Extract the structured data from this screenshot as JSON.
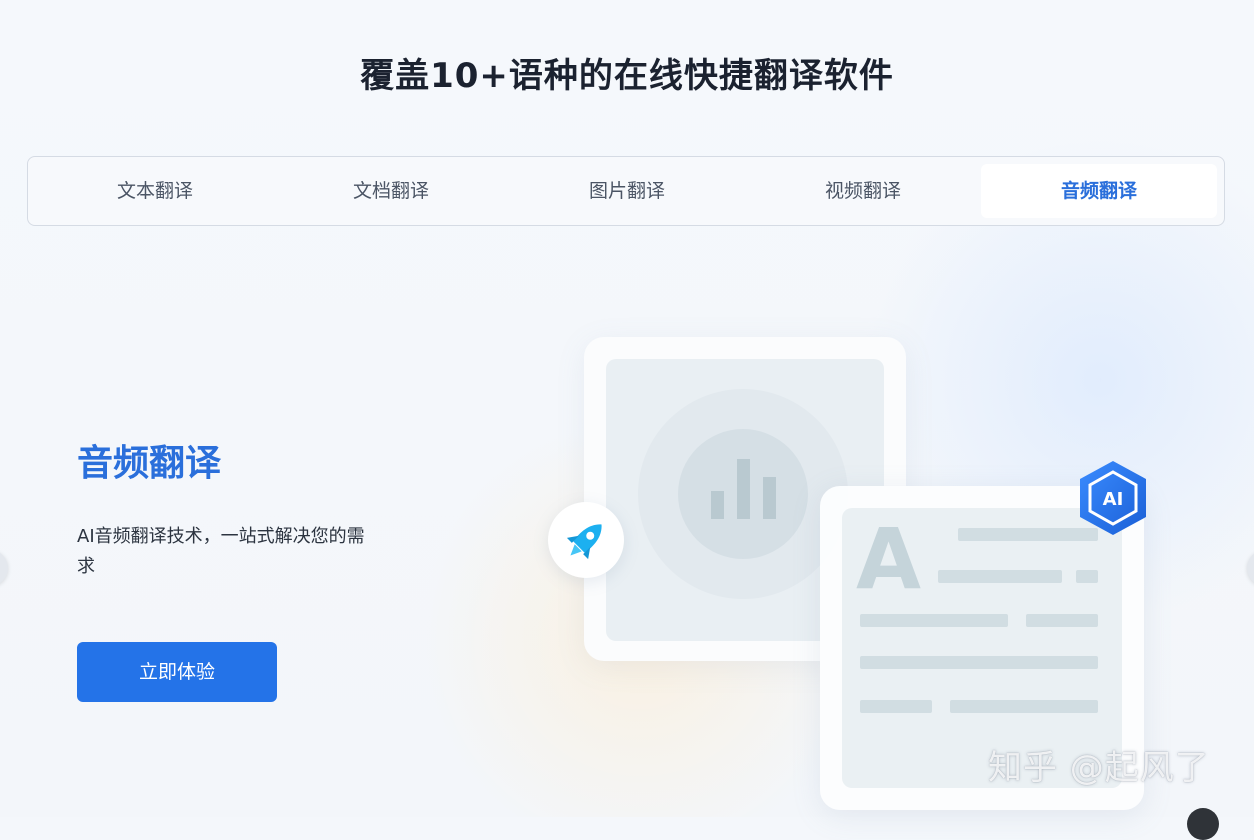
{
  "headline": "覆盖10+语种的在线快捷翻译软件",
  "tabs": [
    {
      "label": "文本翻译",
      "active": false
    },
    {
      "label": "文档翻译",
      "active": false
    },
    {
      "label": "图片翻译",
      "active": false
    },
    {
      "label": "视频翻译",
      "active": false
    },
    {
      "label": "音频翻译",
      "active": true
    }
  ],
  "feature": {
    "title": "音频翻译",
    "description": "AI音频翻译技术，一站式解决您的需求",
    "cta_label": "立即体验"
  },
  "illustration": {
    "ai_badge_text": "AI",
    "document_letter": "A",
    "icons": [
      "audio-bars-icon",
      "rocket-icon",
      "ai-hexagon-icon"
    ]
  },
  "watermark": "知乎 @起风了",
  "colors": {
    "accent": "#2a6fdb",
    "button": "#2473e8",
    "title": "#1b2230",
    "illustration_muted": "#c5d4da"
  }
}
